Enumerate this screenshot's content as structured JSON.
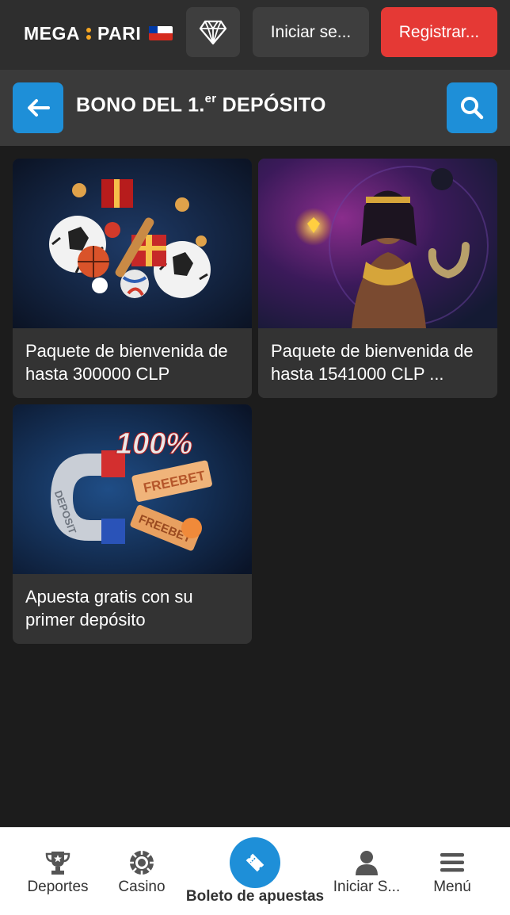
{
  "header": {
    "logo_text_left": "MEGA",
    "logo_text_right": "PARI",
    "login_label": "Iniciar se...",
    "register_label": "Registrar...",
    "accent": "#1e8fd8",
    "register_color": "#e53935"
  },
  "subheader": {
    "title_prefix": "BONO DEL 1.",
    "title_sup": "er",
    "title_suffix": " DEPÓSITO"
  },
  "cards": [
    {
      "label": "Paquete de bienvenida de hasta 300000 CLP",
      "image": "sports-balls-gift-illustration"
    },
    {
      "label": "Paquete de bienvenida de hasta 1541000 CLP ...",
      "image": "cleopatra-casino-illustration"
    },
    {
      "label": "Apuesta gratis con su primer depósito",
      "image": "magnet-freebet-illustration",
      "image_text": "100%",
      "ticket_text": "FREEBET",
      "magnet_text": "DEPOSIT"
    }
  ],
  "bottom_nav": {
    "items": [
      {
        "label": "Deportes",
        "icon": "trophy-icon"
      },
      {
        "label": "Casino",
        "icon": "chip-icon"
      },
      {
        "label": "Iniciar S...",
        "icon": "user-icon"
      },
      {
        "label": "Menú",
        "icon": "menu-icon"
      }
    ],
    "center_label": "Boleto de apuestas",
    "center_icon": "ticket-icon"
  }
}
